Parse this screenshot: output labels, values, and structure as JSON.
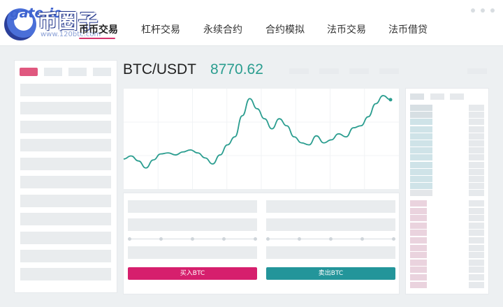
{
  "logo": {
    "brand": "gate.io",
    "watermark": "币圈子",
    "url": "www.120btc.com"
  },
  "nav": {
    "items": [
      {
        "label": "币币交易",
        "active": true
      },
      {
        "label": "杠杆交易",
        "active": false
      },
      {
        "label": "永续合约",
        "active": false
      },
      {
        "label": "合约模拟",
        "active": false
      },
      {
        "label": "法币交易",
        "active": false
      },
      {
        "label": "法币借贷",
        "active": false
      }
    ]
  },
  "market": {
    "pair": "BTC/USDT",
    "price": "8770.62"
  },
  "trade": {
    "buy_label": "买入BTC",
    "sell_label": "卖出BTC"
  },
  "colors": {
    "accent_buy": "#d61f6d",
    "accent_sell": "#23959a",
    "price": "#2a9d8f",
    "line": "#2a9d8f"
  },
  "chart_data": {
    "type": "line",
    "y": [
      0.3,
      0.33,
      0.28,
      0.21,
      0.29,
      0.35,
      0.36,
      0.34,
      0.37,
      0.39,
      0.36,
      0.31,
      0.25,
      0.34,
      0.44,
      0.52,
      0.73,
      0.9,
      0.8,
      0.7,
      0.6,
      0.7,
      0.63,
      0.52,
      0.46,
      0.44,
      0.53,
      0.46,
      0.49,
      0.55,
      0.52,
      0.61,
      0.63,
      0.72,
      0.85,
      0.93,
      0.89
    ]
  }
}
